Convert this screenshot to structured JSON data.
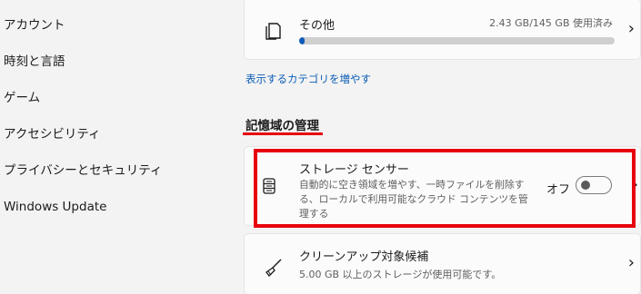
{
  "sidebar": {
    "items": [
      {
        "label": "アカウント"
      },
      {
        "label": "時刻と言語"
      },
      {
        "label": "ゲーム"
      },
      {
        "label": "アクセシビリティ"
      },
      {
        "label": "プライバシーとセキュリティ"
      },
      {
        "label": "Windows Update"
      }
    ]
  },
  "other": {
    "title": "その他",
    "usage": "2.43 GB/145 GB 使用済み",
    "progress_fraction": 0.0168,
    "icon": "document-stack-icon"
  },
  "more_categories_link": "表示するカテゴリを増やす",
  "storage_management": {
    "section_title": "記憶域の管理",
    "storage_sense": {
      "title": "ストレージ センサー",
      "description": "自動的に空き領域を増やす、一時ファイルを削除する、ローカルで利用可能なクラウド コンテンツを管理する",
      "toggle_label": "オフ",
      "toggle_on": false,
      "icon": "storage-drive-icon"
    },
    "cleanup": {
      "title": "クリーンアップ対象候補",
      "description": "5.00 GB 以上のストレージが使用可能です。",
      "icon": "broom-icon"
    }
  },
  "colors": {
    "accent": "#0f5cb8",
    "highlight": "#e8000e",
    "link": "#0a5db5"
  }
}
